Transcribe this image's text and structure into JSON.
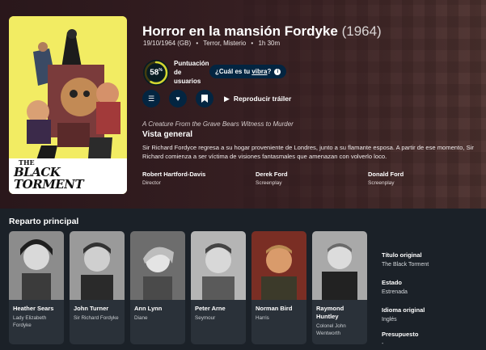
{
  "movie": {
    "title": "Horror en la mansión Fordyke",
    "year": "(1964)",
    "release": "19/10/1964 (GB)",
    "genres": "Terror, Misterio",
    "runtime": "1h 30m",
    "score": "58",
    "score_pct": 58,
    "score_label": "Puntuación de usuarios",
    "vibe_prefix": "¿Cuál es tu ",
    "vibe_link": "vibra",
    "vibe_suffix": "?",
    "trailer": "Reproducir tráiler",
    "tagline": "A Creature From the Grave Bears Witness to Murder",
    "overview_heading": "Vista general",
    "overview": "Sir Richard Fordyce regresa a su hogar proveniente de Londres, junto a su flamante esposa. A partir de ese momento, Sir Richard comienza a ser víctima de visiones fantasmales que amenazan con volverlo loco."
  },
  "poster": {
    "the": "THE",
    "title": "BLACK TORMENT"
  },
  "crew": [
    {
      "name": "Robert Hartford-Davis",
      "job": "Director"
    },
    {
      "name": "Derek Ford",
      "job": "Screenplay"
    },
    {
      "name": "Donald Ford",
      "job": "Screenplay"
    }
  ],
  "cast_heading": "Reparto principal",
  "cast": [
    {
      "name": "Heather Sears",
      "role": "Lady Elizabeth Fordyke"
    },
    {
      "name": "John Turner",
      "role": "Sir Richard Fordyke"
    },
    {
      "name": "Ann Lynn",
      "role": "Diane"
    },
    {
      "name": "Peter Arne",
      "role": "Seymour"
    },
    {
      "name": "Norman Bird",
      "role": "Harris"
    },
    {
      "name": "Raymond Huntley",
      "role": "Colonel John Wentworth"
    }
  ],
  "facts": [
    {
      "label": "Título original",
      "value": "The Black Torment"
    },
    {
      "label": "Estado",
      "value": "Estrenada"
    },
    {
      "label": "Idioma original",
      "value": "Inglés"
    },
    {
      "label": "Presupuesto",
      "value": "-"
    }
  ],
  "icons": {
    "list": "list-icon",
    "fav": "heart-icon",
    "watch": "bookmark-icon",
    "play": "play-icon"
  },
  "colors": {
    "score_ring": "#d2d531",
    "button_bg": "#032541",
    "poster_bg": "#f2ec63"
  }
}
